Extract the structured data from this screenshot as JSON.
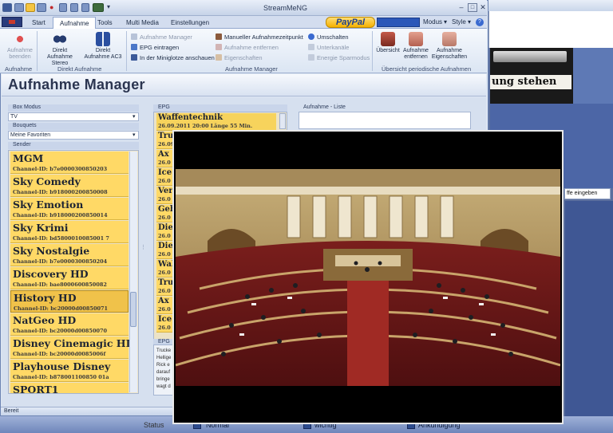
{
  "background": {
    "banner_text": "ung stehen",
    "search_placeholder": "ffe eingeben",
    "bottom_items": [
      "Status",
      "Normal",
      "wichtig",
      "Ankündigung"
    ]
  },
  "window": {
    "title": "StreamMeNG",
    "tabs": [
      "Start",
      "Aufnahme",
      "Tools",
      "Multi Media",
      "Einstellungen"
    ],
    "active_tab": "Aufnahme",
    "paypal_label": "PayPal",
    "right_menu": {
      "modus": "Modus",
      "style": "Style"
    }
  },
  "ribbon": {
    "aufnahme": {
      "label": "Aufnahme",
      "buttons": [
        {
          "label": "Aufnahme beenden",
          "enabled": false
        }
      ]
    },
    "direkt": {
      "label": "Direkt Aufnahme",
      "buttons": [
        {
          "label": "Direkt Aufnahme Stereo"
        },
        {
          "label": "Direkt Aufnahme AC3"
        }
      ]
    },
    "manager": {
      "label": "Aufnahme Manager",
      "col1": [
        {
          "label": "Aufnahme Manager",
          "enabled": false
        },
        {
          "label": "EPG eintragen",
          "enabled": true
        },
        {
          "label": "In der Miniglotze anschauen",
          "enabled": true
        }
      ],
      "col2": [
        {
          "label": "Manueller Aufnahmezeitpunkt",
          "enabled": true
        },
        {
          "label": "Aufnahme entfernen",
          "enabled": false
        },
        {
          "label": "Eigenschaften",
          "enabled": false
        }
      ],
      "col3": [
        {
          "label": "Umschalten",
          "enabled": true
        },
        {
          "label": "Unterkanäle",
          "enabled": false
        },
        {
          "label": "Energie  Sparmodus",
          "enabled": false
        }
      ]
    },
    "periodic": {
      "label": "Übersicht periodische Aufnahmen",
      "buttons": [
        {
          "label": "Übersicht"
        },
        {
          "label": "Aufnahme entfernen"
        },
        {
          "label": "Aufnahme Eigenschaften"
        }
      ]
    }
  },
  "page": {
    "title": "Aufnahme Manager",
    "box_modus": {
      "label": "Box Modus",
      "value": "TV"
    },
    "bouquets": {
      "label": "Bouquets",
      "value": "Meine Favoriten"
    },
    "sender_label": "Sender",
    "senders": [
      {
        "name": "MGM",
        "id": "Channel-ID: b7e0000300850203"
      },
      {
        "name": "Sky Comedy",
        "id": "Channel-ID: b918000200850008"
      },
      {
        "name": "Sky Emotion",
        "id": "Channel-ID: b918000200850014"
      },
      {
        "name": "Sky Krimi",
        "id": "Channel-ID: bd5800010085001 7"
      },
      {
        "name": "Sky Nostalgie",
        "id": "Channel-ID: b7e0000300850204"
      },
      {
        "name": "Discovery HD",
        "id": "Channel-ID: bae8000600850082"
      },
      {
        "name": "History HD",
        "id": "Channel-ID: bc20000d00850071"
      },
      {
        "name": "NatGeo HD",
        "id": "Channel-ID: bc20000d00850070"
      },
      {
        "name": "Disney Cinemagic HD",
        "id": "Channel-ID: bc20000d0085006f"
      },
      {
        "name": "Playhouse Disney",
        "id": "Channel-ID: b878001100850 01a"
      },
      {
        "name": "SPORT1",
        "id": ""
      }
    ],
    "selected_sender": 6,
    "epg_label": "EPG",
    "epg": [
      {
        "title": "Waffentechnik",
        "time": "26.09.2011 20:00 Länge 55 Min."
      },
      {
        "title": "Tru",
        "time": "26.09."
      },
      {
        "title": "Ax",
        "time": "26.0"
      },
      {
        "title": "Ice",
        "time": "26.0"
      },
      {
        "title": "Ver",
        "time": "26.0"
      },
      {
        "title": "Geh",
        "time": "26.0"
      },
      {
        "title": "Die",
        "time": "26.0"
      },
      {
        "title": "Die",
        "time": "26.0"
      },
      {
        "title": "Wal",
        "time": "26.0"
      },
      {
        "title": "Tru",
        "time": "26.0"
      },
      {
        "title": "Ax",
        "time": "26.0"
      },
      {
        "title": "Ice",
        "time": "26.0"
      }
    ],
    "epg_desc_label": "EPG",
    "epg_desc_lines": [
      "Trucke",
      "Hellige",
      "Rick e",
      "darauf",
      "bringe",
      "wagt d"
    ],
    "list_label": "Aufnahme - Liste"
  },
  "status": "Bereit",
  "colors": {
    "accent": "#ffd966",
    "ribbon": "#dbe5f3",
    "video_bg": "#000000"
  }
}
